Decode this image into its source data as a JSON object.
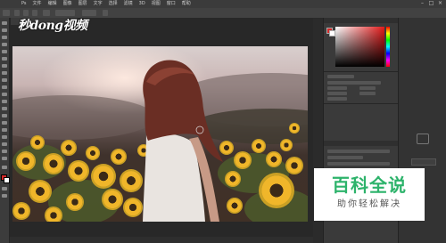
{
  "menubar": {
    "items": [
      "Ps",
      "文件",
      "编辑",
      "图像",
      "图层",
      "文字",
      "选择",
      "滤镜",
      "3D",
      "视图",
      "窗口",
      "帮助"
    ],
    "window_controls": [
      "–",
      "□",
      "×"
    ]
  },
  "watermark": {
    "site_logo": "秒dong视频"
  },
  "overlay": {
    "title": "百科全说",
    "subtitle": "助你轻松解决"
  },
  "colors": {
    "foreground": "#d42a2a",
    "background": "#ffffff",
    "overlay_green": "#2db36b"
  }
}
